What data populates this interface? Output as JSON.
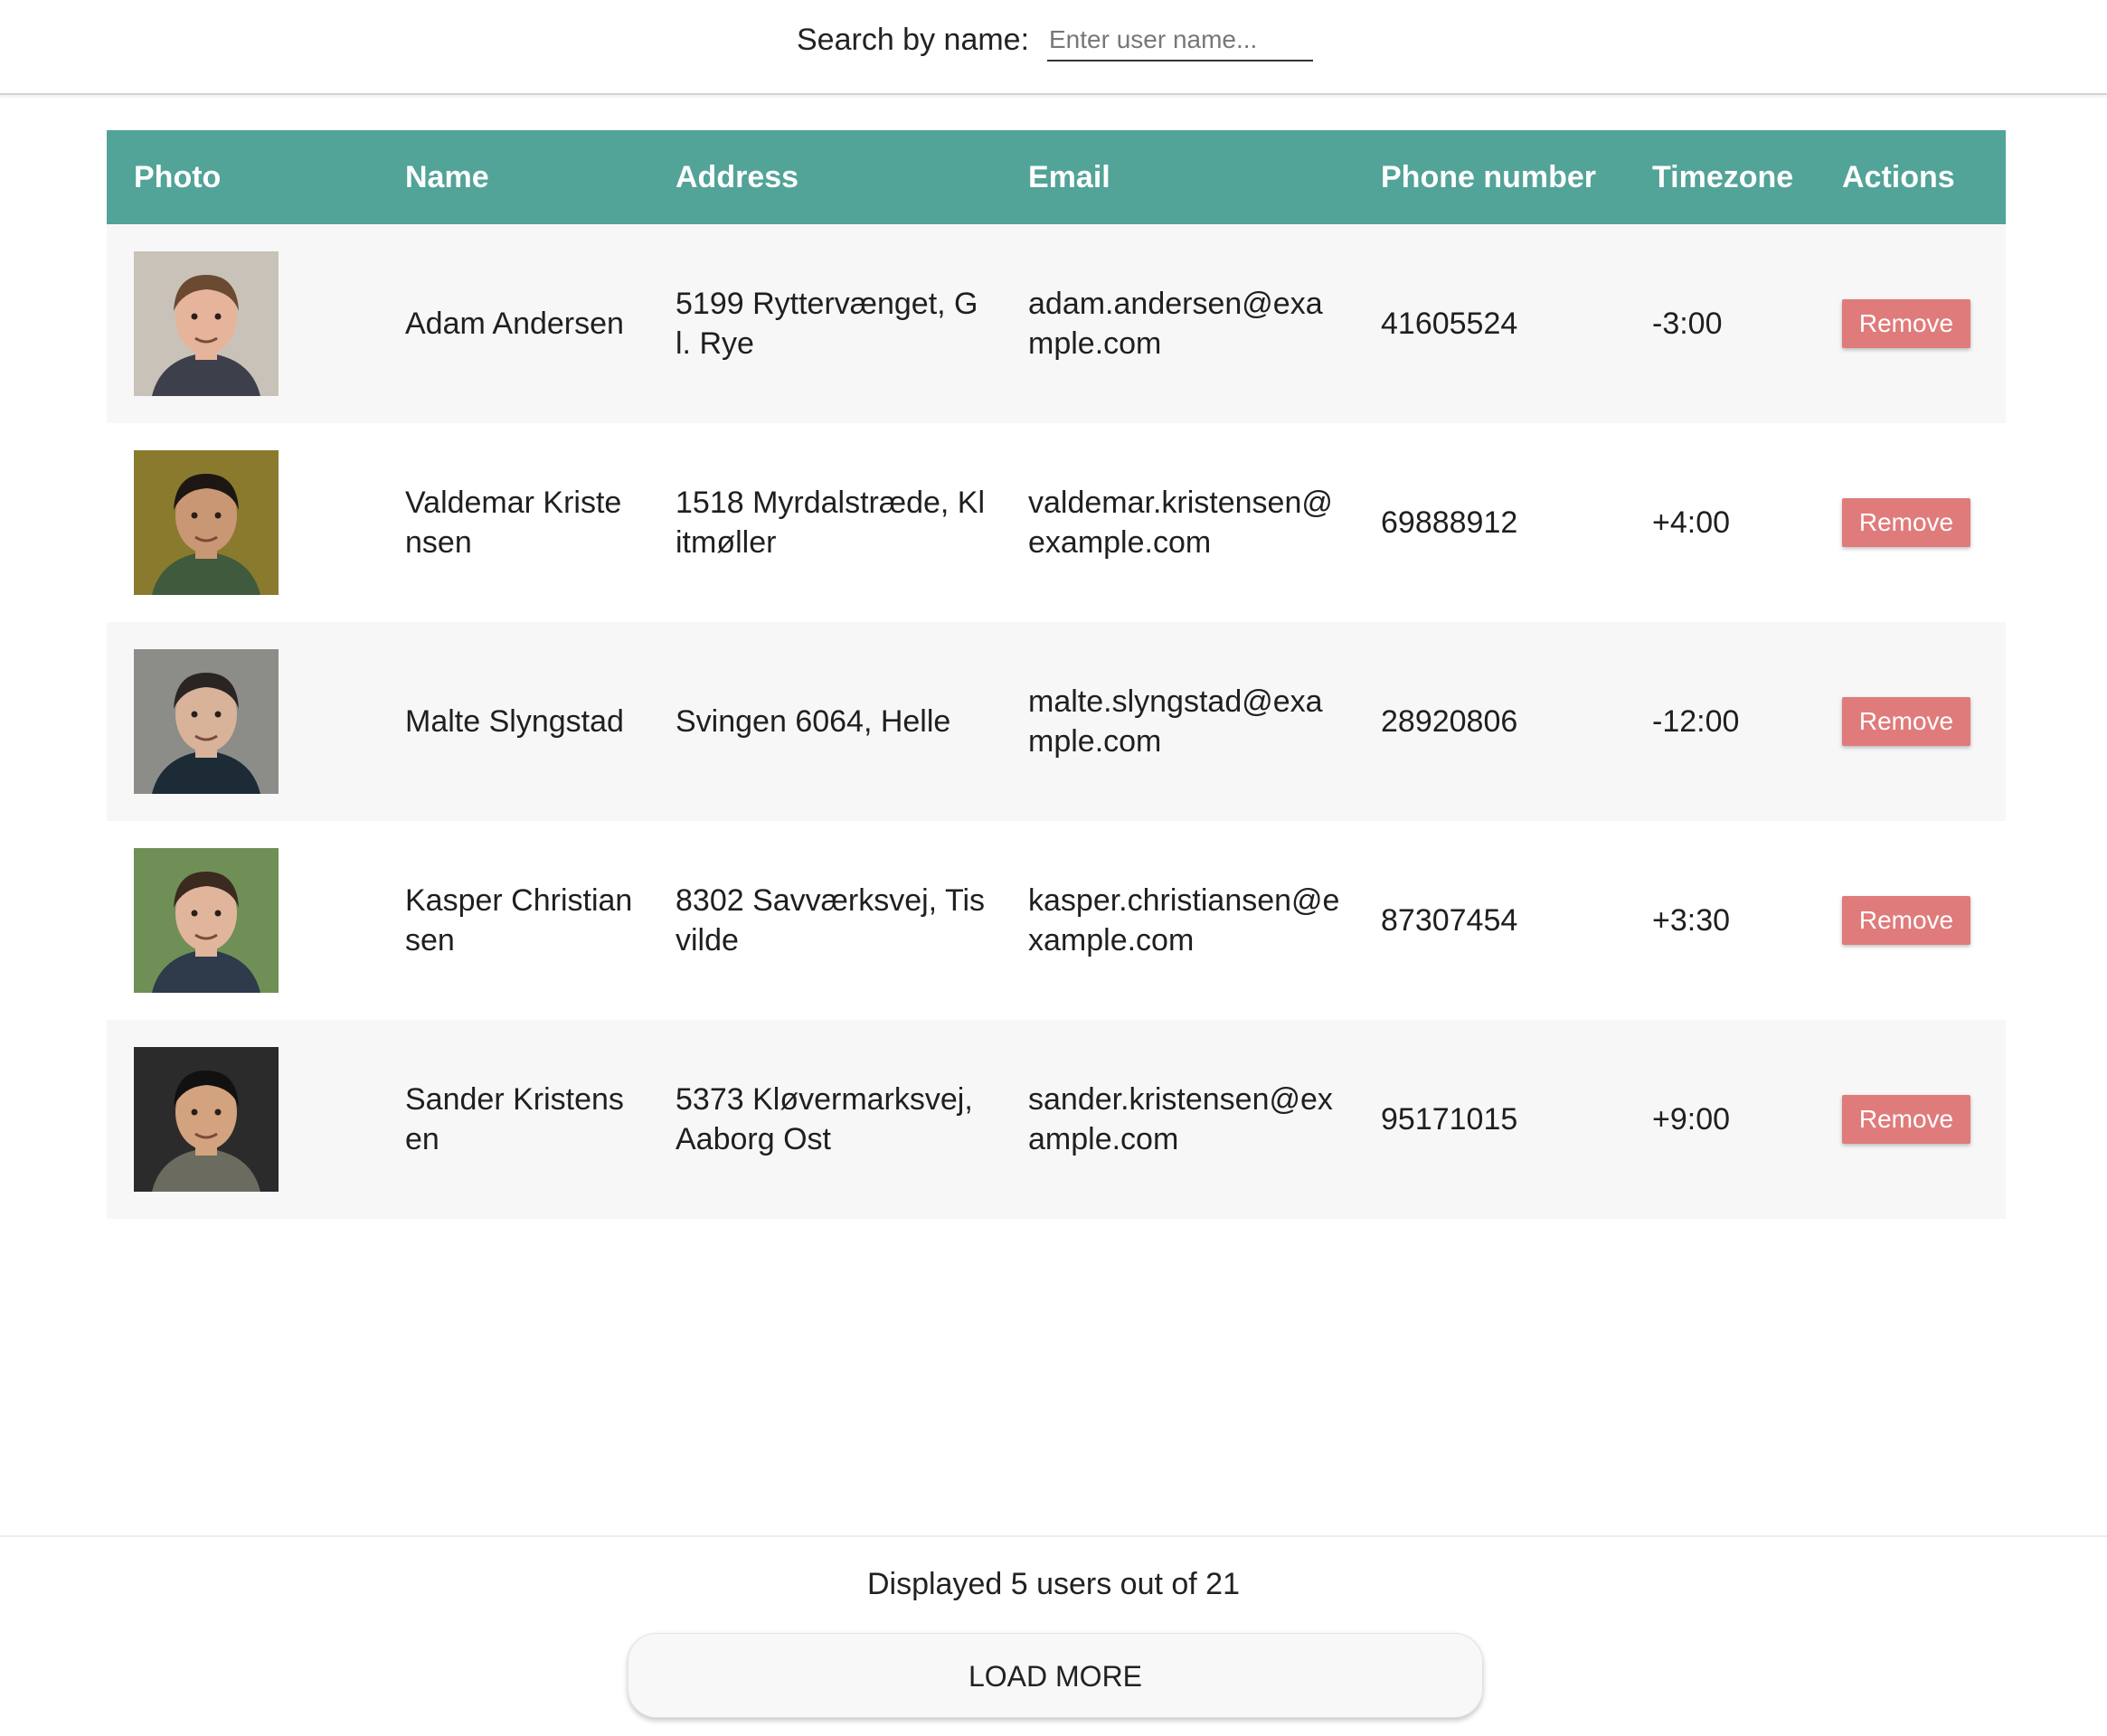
{
  "search": {
    "label": "Search by name:",
    "placeholder": "Enter user name...",
    "value": ""
  },
  "table": {
    "header_bg": "#52a398",
    "columns": [
      "Photo",
      "Name",
      "Address",
      "Email",
      "Phone number",
      "Timezone",
      "Actions"
    ],
    "rows": [
      {
        "name": "Adam Andersen",
        "address": "5199 Ryttervænget, Gl. Rye",
        "email": "adam.andersen@example.com",
        "phone": "41605524",
        "timezone": "-3:00",
        "action": "Remove",
        "photo": {
          "bg": "#c9c2b8",
          "skin": "#e6b49a",
          "hair": "#6b4a32",
          "shirt": "#3d3f4a"
        }
      },
      {
        "name": "Valdemar Kristensen",
        "address": "1518 Myrdalstræde, Klitmøller",
        "email": "valdemar.kristensen@example.com",
        "phone": "69888912",
        "timezone": "+4:00",
        "action": "Remove",
        "photo": {
          "bg": "#8a7a2e",
          "skin": "#c99774",
          "hair": "#1c1712",
          "shirt": "#3f5a3c"
        }
      },
      {
        "name": "Malte Slyngstad",
        "address": "Svingen 6064, Helle",
        "email": "malte.slyngstad@example.com",
        "phone": "28920806",
        "timezone": "-12:00",
        "action": "Remove",
        "photo": {
          "bg": "#8c8c88",
          "skin": "#d8b39a",
          "hair": "#2a2523",
          "shirt": "#1d2b36"
        }
      },
      {
        "name": "Kasper Christiansen",
        "address": "8302 Savværksvej, Tisvilde",
        "email": "kasper.christiansen@example.com",
        "phone": "87307454",
        "timezone": "+3:30",
        "action": "Remove",
        "photo": {
          "bg": "#6f8f56",
          "skin": "#e1b59c",
          "hair": "#3a2a1f",
          "shirt": "#2d3b4a"
        }
      },
      {
        "name": "Sander Kristensen",
        "address": "5373 Kløvermarksvej, Aaborg Ost",
        "email": "sander.kristensen@example.com",
        "phone": "95171015",
        "timezone": "+9:00",
        "action": "Remove",
        "photo": {
          "bg": "#2b2b2b",
          "skin": "#d2a37e",
          "hair": "#111111",
          "shirt": "#6b6b60"
        }
      }
    ]
  },
  "footer": {
    "status": "Displayed 5 users out of 21",
    "load_more_label": "LOAD MORE"
  },
  "colors": {
    "accent": "#52a398",
    "remove": "#e07b7b"
  }
}
